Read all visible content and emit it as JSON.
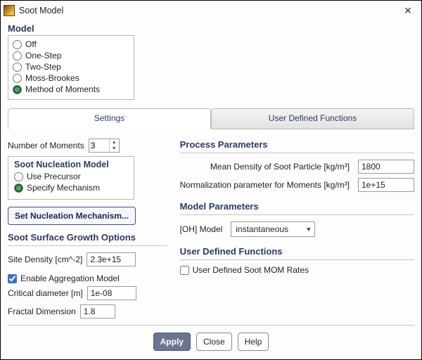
{
  "window": {
    "title": "Soot Model"
  },
  "model_section_title": "Model",
  "model_options": {
    "off": "Off",
    "one_step": "One-Step",
    "two_step": "Two-Step",
    "moss": "Moss-Brookes",
    "mom": "Method of Moments",
    "selected": "mom"
  },
  "tabs": {
    "settings": "Settings",
    "udf": "User Defined Functions",
    "active": "settings"
  },
  "moments": {
    "label": "Number of Moments",
    "value": "3"
  },
  "nucleation": {
    "title": "Soot Nucleation Model",
    "use_precursor": "Use Precursor",
    "specify": "Specify Mechanism",
    "selected": "specify",
    "button": "Set Nucleation Mechanism..."
  },
  "growth": {
    "title": "Soot Surface Growth Options",
    "site_density_label": "Site Density [cm^-2]",
    "site_density_value": "2.3e+15",
    "aggregation_label": "Enable Aggregation Model",
    "aggregation_checked": true,
    "crit_diam_label": "Critical diameter [m]",
    "crit_diam_value": "1e-08",
    "fractal_label": "Fractal Dimension",
    "fractal_value": "1.8"
  },
  "process": {
    "title": "Process Parameters",
    "density_label": "Mean Density of Soot Particle [kg/m³]",
    "density_value": "1800",
    "norm_label": "Normalization parameter for Moments [kg/m³]",
    "norm_value": "1e+15"
  },
  "model_params": {
    "title": "Model Parameters",
    "oh_label": "[OH] Model",
    "oh_value": "instantaneous"
  },
  "udf_box": {
    "title": "User Defined Functions",
    "rates_label": "User Defined Soot MOM Rates",
    "rates_checked": false
  },
  "buttons": {
    "apply": "Apply",
    "close": "Close",
    "help": "Help"
  }
}
